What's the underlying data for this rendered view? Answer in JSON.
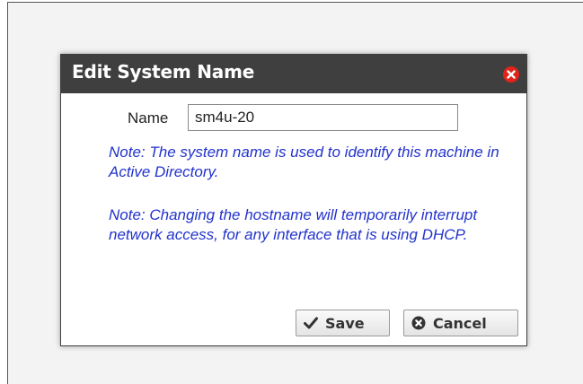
{
  "dialog": {
    "title": "Edit System Name",
    "close_icon": "close-icon",
    "name_label": "Name",
    "name_value": "sm4u-20",
    "note1": "Note: The system name is used to identify this machine in Active Directory.",
    "note2": "Note: Changing the hostname will temporarily interrupt network access, for any interface that is using DHCP.",
    "save_label": "Save",
    "cancel_label": "Cancel",
    "save_icon": "checkmark-icon",
    "cancel_icon": "cancel-circle-icon"
  },
  "colors": {
    "titlebar_bg": "#3f3f3f",
    "close_red": "#e2231a",
    "note_blue": "#2233cc"
  }
}
